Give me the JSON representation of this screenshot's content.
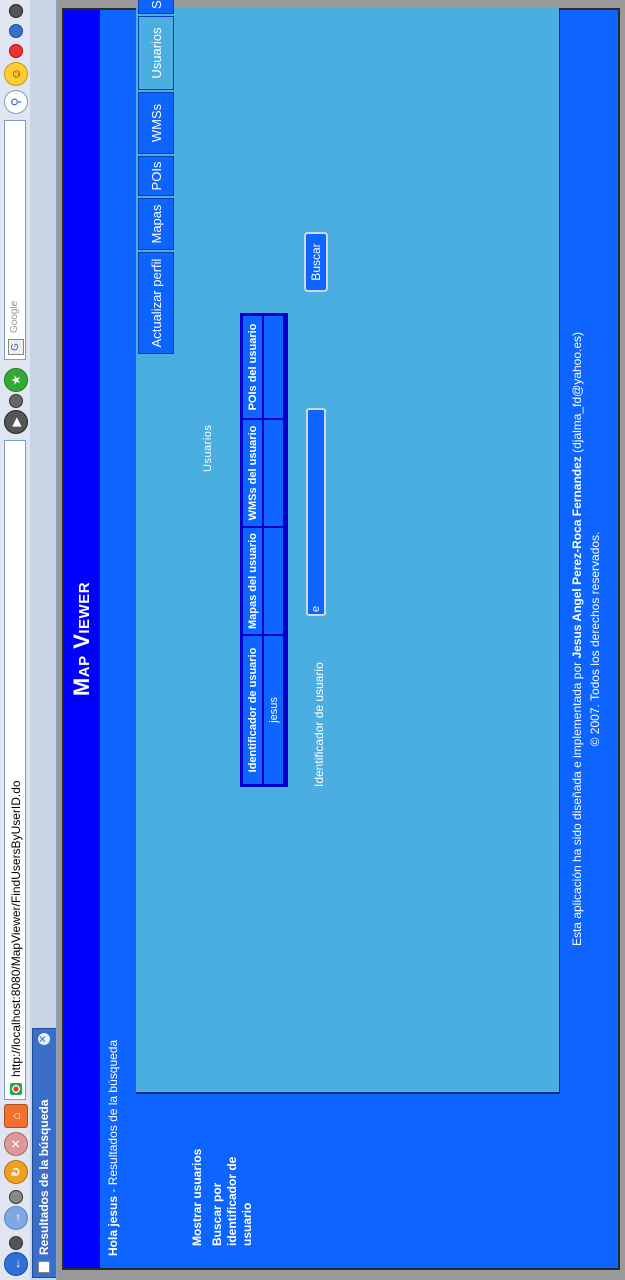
{
  "browser": {
    "url": "http://localhost:8080/MapViewer/FindUsersByUserID.do",
    "search_placeholder": "Google",
    "tab_title": "Resultados de la búsqueda"
  },
  "app": {
    "title": "Map Viewer",
    "greeting_prefix": "Hola",
    "greeting_user": "jesus",
    "greeting_suffix": " - Resultados de la búsqueda"
  },
  "sidebar": {
    "items": [
      {
        "label": "Mostrar usuarios"
      },
      {
        "label": "Buscar por identificador de usuario"
      }
    ]
  },
  "nav": {
    "items": [
      {
        "label": "Actualizar perfil"
      },
      {
        "label": "Mapas"
      },
      {
        "label": "POIs"
      },
      {
        "label": "WMSs"
      },
      {
        "label": "Usuarios"
      },
      {
        "label": "Salir"
      }
    ],
    "active": "Usuarios"
  },
  "main": {
    "section_title": "Usuarios",
    "table": {
      "headers": [
        "Identificador de usuario",
        "Mapas del usuario",
        "WMSs del usuario",
        "POIs del usuario"
      ],
      "rows": [
        [
          "jesus",
          "",
          "",
          ""
        ]
      ]
    },
    "search": {
      "label": "Identificador de usuario",
      "value": "e",
      "button_label": "Buscar"
    }
  },
  "footer": {
    "line1_prefix": "Esta aplicación ha sido diseñada e implementada por ",
    "line1_author": "Jesus Angel Perez-Roca Fernandez",
    "line1_suffix": " (djalma_fd@yahoo.es)",
    "line2": "© 2007. Todos los derechos reservados."
  },
  "colors": {
    "header_blue": "#0000ff",
    "panel_blue": "#0d64ff",
    "main_light_blue": "#4aaee0"
  }
}
